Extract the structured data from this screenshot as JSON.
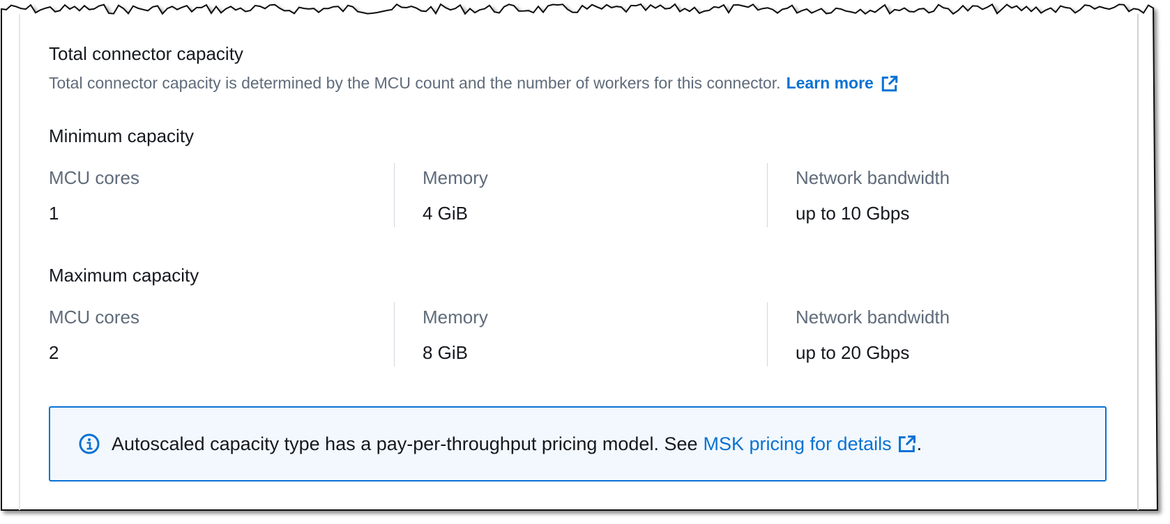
{
  "section": {
    "title": "Total connector capacity",
    "description": "Total connector capacity is determined by the MCU count and the number of workers for this connector.",
    "learn_more": "Learn more"
  },
  "minimum": {
    "heading": "Minimum capacity",
    "mcu_label": "MCU cores",
    "mcu_value": "1",
    "memory_label": "Memory",
    "memory_value": "4 GiB",
    "bandwidth_label": "Network bandwidth",
    "bandwidth_value": "up to 10 Gbps"
  },
  "maximum": {
    "heading": "Maximum capacity",
    "mcu_label": "MCU cores",
    "mcu_value": "2",
    "memory_label": "Memory",
    "memory_value": "8 GiB",
    "bandwidth_label": "Network bandwidth",
    "bandwidth_value": "up to 20 Gbps"
  },
  "alert": {
    "text": "Autoscaled capacity type has a pay-per-throughput pricing model. See",
    "link": "MSK pricing for details",
    "suffix": "."
  },
  "colors": {
    "link": "#0972d3",
    "text": "#16191f",
    "muted": "#5f6b7a",
    "alert_bg": "#f2f8fd"
  },
  "icons": [
    "external-link-icon",
    "info-icon"
  ]
}
